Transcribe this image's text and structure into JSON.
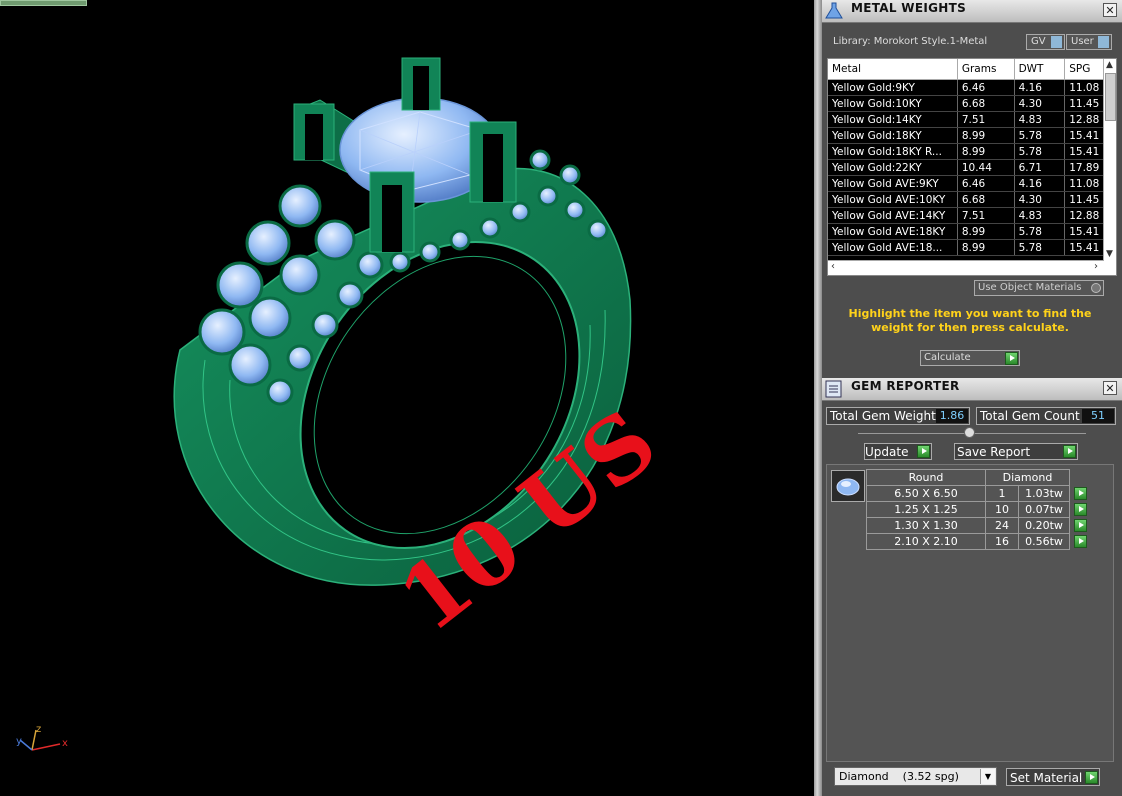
{
  "viewport": {
    "size_text": "10 US",
    "axis": {
      "x": "x",
      "y": "y",
      "z": "z"
    }
  },
  "metal_weights": {
    "title": "METAL WEIGHTS",
    "library_label": "Library: Morokort Style.1-Metal",
    "gv_label": "GV",
    "user_label": "User",
    "columns": [
      "Metal",
      "Grams",
      "DWT",
      "SPG"
    ],
    "rows": [
      [
        "Yellow Gold:9KY",
        "6.46",
        "4.16",
        "11.08"
      ],
      [
        "Yellow Gold:10KY",
        "6.68",
        "4.30",
        "11.45"
      ],
      [
        "Yellow Gold:14KY",
        "7.51",
        "4.83",
        "12.88"
      ],
      [
        "Yellow Gold:18KY",
        "8.99",
        "5.78",
        "15.41"
      ],
      [
        "Yellow Gold:18KY R...",
        "8.99",
        "5.78",
        "15.41"
      ],
      [
        "Yellow Gold:22KY",
        "10.44",
        "6.71",
        "17.89"
      ],
      [
        "Yellow Gold AVE:9KY",
        "6.46",
        "4.16",
        "11.08"
      ],
      [
        "Yellow Gold AVE:10KY",
        "6.68",
        "4.30",
        "11.45"
      ],
      [
        "Yellow Gold AVE:14KY",
        "7.51",
        "4.83",
        "12.88"
      ],
      [
        "Yellow Gold AVE:18KY",
        "8.99",
        "5.78",
        "15.41"
      ],
      [
        "Yellow Gold AVE:18...",
        "8.99",
        "5.78",
        "15.41"
      ]
    ],
    "use_object_materials": "Use Object Materials",
    "instruction": "Highlight the item you want to find the weight for then press calculate.",
    "calculate_label": "Calculate"
  },
  "gem_reporter": {
    "title": "GEM REPORTER",
    "total_weight_label": "Total Gem Weight",
    "total_weight_value": "1.86",
    "total_count_label": "Total Gem Count",
    "total_count_value": "51",
    "update_label": "Update",
    "save_report_label": "Save Report",
    "shape_header": "Round",
    "material_header": "Diamond",
    "gems": [
      {
        "size": "6.50 X 6.50",
        "count": "1",
        "weight": "1.03tw"
      },
      {
        "size": "1.25 X 1.25",
        "count": "10",
        "weight": "0.07tw"
      },
      {
        "size": "1.30 X 1.30",
        "count": "24",
        "weight": "0.20tw"
      },
      {
        "size": "2.10 X 2.10",
        "count": "16",
        "weight": "0.56tw"
      }
    ],
    "material_select_value": "Diamond    (3.52 spg)",
    "set_material_label": "Set Material"
  },
  "colors": {
    "ring": "#0f7a50",
    "gem": "#8fb8f2",
    "size_text": "#e8101a",
    "instruction": "#ffd21a"
  }
}
